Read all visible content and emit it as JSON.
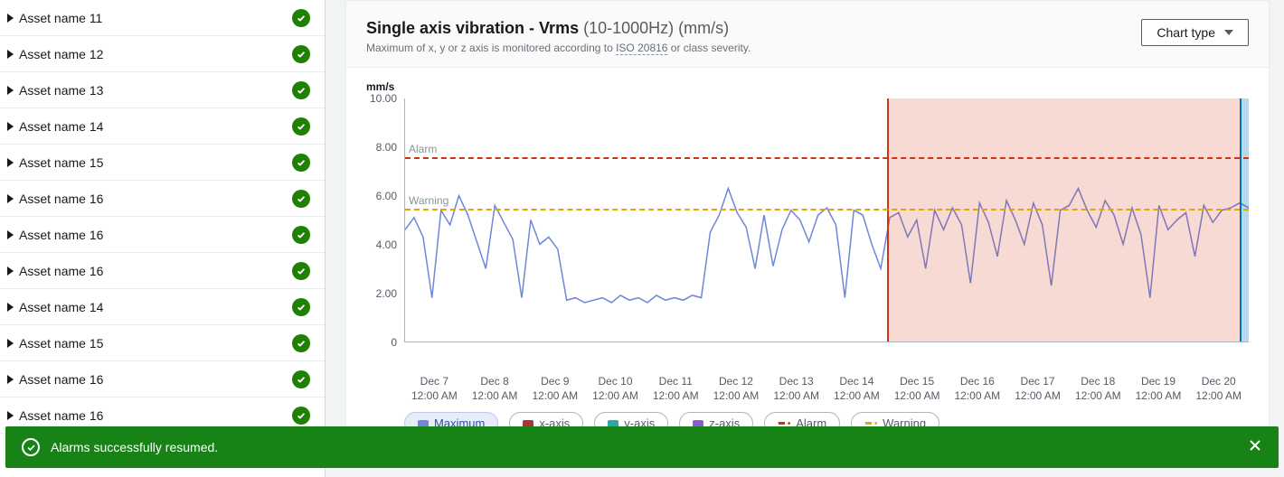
{
  "sidebar": {
    "items": [
      {
        "label": "Asset name 11",
        "status": "ok"
      },
      {
        "label": "Asset name 12",
        "status": "ok"
      },
      {
        "label": "Asset name 13",
        "status": "ok"
      },
      {
        "label": "Asset name 14",
        "status": "ok"
      },
      {
        "label": "Asset name 15",
        "status": "ok"
      },
      {
        "label": "Asset name 16",
        "status": "ok"
      },
      {
        "label": "Asset name 16",
        "status": "ok"
      },
      {
        "label": "Asset name 16",
        "status": "ok"
      },
      {
        "label": "Asset name 14",
        "status": "ok"
      },
      {
        "label": "Asset name 15",
        "status": "ok"
      },
      {
        "label": "Asset name 16",
        "status": "ok"
      },
      {
        "label": "Asset name 16",
        "status": "ok"
      }
    ]
  },
  "header": {
    "title_bold": "Single axis vibration - Vrms",
    "title_light": "(10-1000Hz) (mm/s)",
    "subtitle_pre": "Maximum of x, y or z axis is monitored according to ",
    "subtitle_iso": "ISO 20816",
    "subtitle_post": " or class severity.",
    "chart_type_label": "Chart type"
  },
  "chart_data": {
    "type": "line",
    "y_unit": "mm/s",
    "ylim": [
      0,
      10
    ],
    "yticks": [
      0,
      2.0,
      4.0,
      6.0,
      8.0,
      10.0
    ],
    "ytick_labels": [
      "0",
      "2.00",
      "4.00",
      "6.00",
      "8.00",
      "10.00"
    ],
    "thresholds": {
      "alarm": {
        "label": "Alarm",
        "value": 7.6,
        "color": "#d13212"
      },
      "warning": {
        "label": "Warning",
        "value": 5.5,
        "color": "#e0a800"
      }
    },
    "highlight_bands": [
      {
        "type": "alarm",
        "x_start_index": 8,
        "x_end_index": 13.85,
        "color": "rgba(209,50,18,0.18)",
        "border": "#d13212"
      },
      {
        "type": "current",
        "x_start_index": 13.85,
        "x_end_index": 14,
        "color": "rgba(0,115,187,0.28)",
        "border": "#0073bb"
      }
    ],
    "x_categories": [
      "Dec 7",
      "Dec 8",
      "Dec 9",
      "Dec 10",
      "Dec 11",
      "Dec 12",
      "Dec 13",
      "Dec 14",
      "Dec 15",
      "Dec 16",
      "Dec 17",
      "Dec 18",
      "Dec 19",
      "Dec 20"
    ],
    "x_sub": "12:00 AM",
    "series": [
      {
        "name": "Maximum",
        "color": "#6f87d8",
        "values": [
          4.6,
          5.1,
          4.3,
          1.8,
          5.4,
          4.8,
          6.0,
          5.2,
          4.1,
          3.0,
          5.6,
          4.9,
          4.2,
          1.8,
          5.0,
          4.0,
          4.3,
          3.8,
          1.7,
          1.8,
          1.6,
          1.7,
          1.8,
          1.6,
          1.9,
          1.7,
          1.8,
          1.6,
          1.9,
          1.7,
          1.8,
          1.7,
          1.9,
          1.8,
          4.5,
          5.2,
          6.3,
          5.3,
          4.7,
          3.0,
          5.2,
          3.1,
          4.6,
          5.4,
          5.0,
          4.1,
          5.2,
          5.5,
          4.8,
          1.8,
          5.4,
          5.2,
          4.0,
          3.0,
          5.1,
          5.3,
          4.3,
          5.0,
          3.0,
          5.4,
          4.6,
          5.5,
          4.8,
          2.4,
          5.7,
          4.9,
          3.5,
          5.8,
          5.0,
          4.0,
          5.7,
          4.8,
          2.3,
          5.4,
          5.6,
          6.3,
          5.4,
          4.7,
          5.8,
          5.2,
          4.0,
          5.5,
          4.4,
          1.8,
          5.6,
          4.6,
          5.0,
          5.3,
          3.5,
          5.6,
          4.9,
          5.4,
          5.5,
          5.7,
          5.5
        ]
      }
    ],
    "legend": [
      {
        "id": "maximum",
        "label": "Maximum",
        "color": "#6f87d8",
        "style": "solid",
        "active": true
      },
      {
        "id": "x-axis",
        "label": "x-axis",
        "color": "#b0353a",
        "style": "solid",
        "active": false
      },
      {
        "id": "y-axis",
        "label": "y-axis",
        "color": "#2ca8a0",
        "style": "solid",
        "active": false
      },
      {
        "id": "z-axis",
        "label": "z-axis",
        "color": "#8c5bd6",
        "style": "solid",
        "active": false
      },
      {
        "id": "alarm",
        "label": "Alarm",
        "color": "#d13212",
        "style": "dash",
        "active": false
      },
      {
        "id": "warning",
        "label": "Warning",
        "color": "#e0a800",
        "style": "dash",
        "active": false
      }
    ]
  },
  "toast": {
    "message": "Alarms successfully resumed."
  }
}
